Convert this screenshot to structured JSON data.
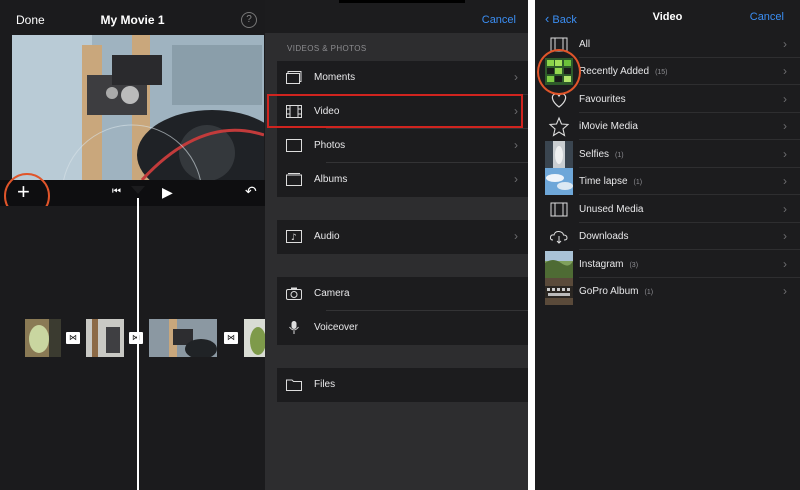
{
  "panel1": {
    "done_label": "Done",
    "title": "My Movie 1",
    "help_icon": "?",
    "add_icon": "+",
    "play_icon": "▶",
    "skip_back_icon": "⏮",
    "undo_icon": "↶",
    "transition_icon": "⋈"
  },
  "panel2": {
    "cancel_label": "Cancel",
    "section_header": "VIDEOS & PHOTOS",
    "items": [
      {
        "label": "Moments",
        "icon": "moments-icon",
        "chevron": "›"
      },
      {
        "label": "Video",
        "icon": "film-icon",
        "chevron": "›"
      },
      {
        "label": "Photos",
        "icon": "photo-frame-icon",
        "chevron": "›"
      },
      {
        "label": "Albums",
        "icon": "albums-icon",
        "chevron": "›"
      },
      {
        "label": "Audio",
        "icon": "music-note-icon",
        "chevron": "›"
      },
      {
        "label": "Camera",
        "icon": "camera-icon",
        "chevron": ""
      },
      {
        "label": "Voiceover",
        "icon": "microphone-icon",
        "chevron": ""
      },
      {
        "label": "Files",
        "icon": "folder-icon",
        "chevron": ""
      }
    ]
  },
  "panel3": {
    "back_label": "Back",
    "title": "Video",
    "cancel_label": "Cancel",
    "items": [
      {
        "label": "All",
        "count": "",
        "icon": "film-icon"
      },
      {
        "label": "Recently Added",
        "count": "(15)",
        "icon": "thumbnail-grid"
      },
      {
        "label": "Favourites",
        "count": "",
        "icon": "heart-icon"
      },
      {
        "label": "iMovie Media",
        "count": "",
        "icon": "star-icon"
      },
      {
        "label": "Selfies",
        "count": "(1)",
        "icon": "thumbnail-selfie"
      },
      {
        "label": "Time lapse",
        "count": "(1)",
        "icon": "thumbnail-sky"
      },
      {
        "label": "Unused Media",
        "count": "",
        "icon": "film-icon"
      },
      {
        "label": "Downloads",
        "count": "",
        "icon": "cloud-download-icon"
      },
      {
        "label": "Instagram",
        "count": "(3)",
        "icon": "thumbnail-landscape"
      },
      {
        "label": "GoPro Album",
        "count": "(1)",
        "icon": "thumbnail-keyboard"
      }
    ],
    "chevron": "›"
  },
  "colors": {
    "accent_blue": "#3b8ef3",
    "highlight_red": "#d0241f",
    "annotation_orange": "#e0552a"
  }
}
